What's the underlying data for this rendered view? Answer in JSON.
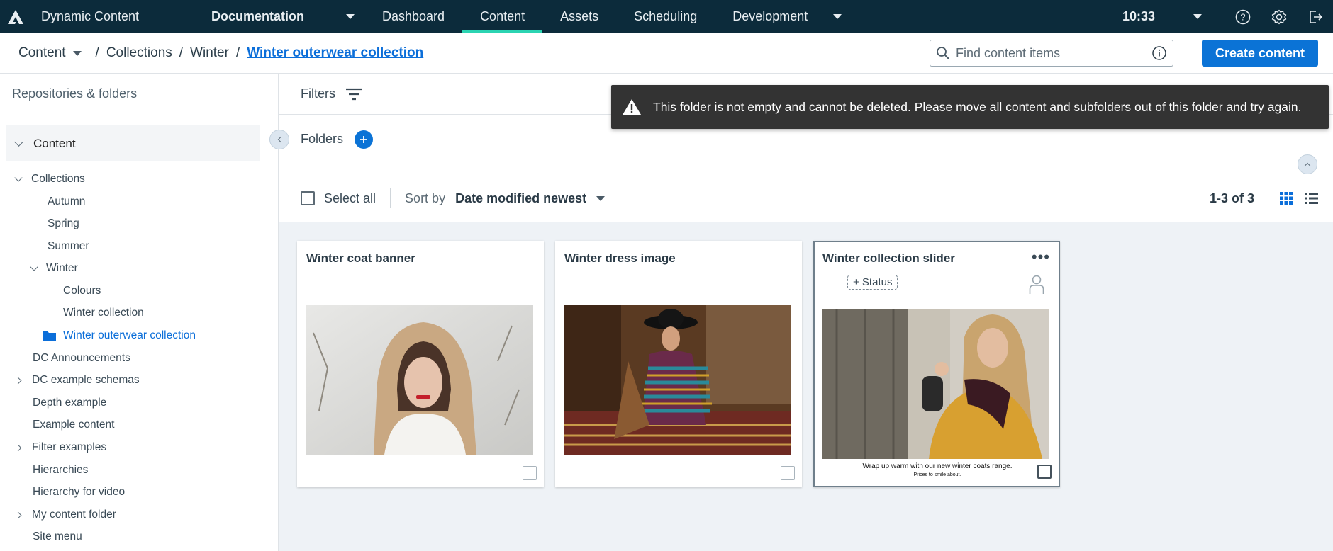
{
  "topbar": {
    "app_title": "Dynamic Content",
    "workspace": "Documentation",
    "tabs": [
      "Dashboard",
      "Content",
      "Assets",
      "Scheduling",
      "Development"
    ],
    "active_tab": "Content",
    "time": "10:33",
    "icons": [
      "help-icon",
      "settings-icon",
      "logout-icon"
    ]
  },
  "breadcrumb": {
    "root": "Content",
    "items": [
      "Collections",
      "Winter"
    ],
    "current": "Winter outerwear collection",
    "separator": "/"
  },
  "search": {
    "placeholder": "Find content items"
  },
  "create_button": "Create content",
  "sidebar": {
    "title": "Repositories & folders",
    "root": "Content",
    "tree": [
      {
        "label": "Collections",
        "expander": "down"
      },
      {
        "label": "Autumn"
      },
      {
        "label": "Spring"
      },
      {
        "label": "Summer"
      },
      {
        "label": "Winter",
        "expander": "down"
      },
      {
        "label": "Colours"
      },
      {
        "label": "Winter collection"
      },
      {
        "label": "Winter outerwear collection",
        "active": true
      },
      {
        "label": "DC Announcements"
      },
      {
        "label": "DC example schemas",
        "expander": "right"
      },
      {
        "label": "Depth example"
      },
      {
        "label": "Example content"
      },
      {
        "label": "Filter examples",
        "expander": "right"
      },
      {
        "label": "Hierarchies"
      },
      {
        "label": "Hierarchy for video"
      },
      {
        "label": "My content folder",
        "expander": "right"
      },
      {
        "label": "Site menu"
      }
    ]
  },
  "filters_label": "Filters",
  "folders_label": "Folders",
  "toast": {
    "message": "This folder is not empty and cannot be deleted. Please move all content and subfolders out of this folder and try again."
  },
  "toolbar": {
    "select_all": "Select all",
    "sort_by_label": "Sort by",
    "sort_value": "Date modified newest",
    "count": "1-3 of 3"
  },
  "cards": [
    {
      "title": "Winter coat banner"
    },
    {
      "title": "Winter dress image"
    },
    {
      "title": "Winter collection slider",
      "status": "+ Status",
      "caption": "Wrap up warm with our new winter coats range.",
      "caption_sub": "Prices to smile about."
    }
  ],
  "colors": {
    "topbar_bg": "#0c2b3b",
    "active_tab_underline": "#2bd4b2",
    "primary": "#0b73d6",
    "link": "#0b6ed9",
    "toast_bg": "#333333",
    "cards_bg": "#eef2f6"
  }
}
